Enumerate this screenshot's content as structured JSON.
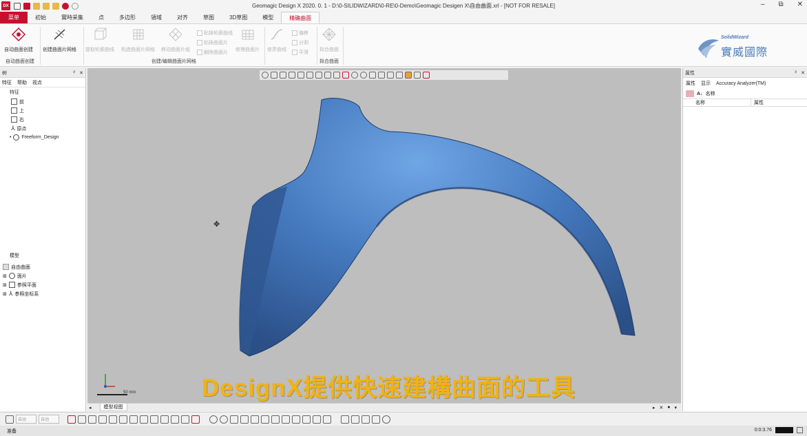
{
  "window": {
    "title": "Geomagic Design X 2020. 0. 1 - D:\\0-SILIDWIZARD\\0-RE\\0-Demo\\Geomagic Desigen X\\自由曲面.xrl - [NOT FOR RESALE]",
    "app_logo": "DX",
    "minimize": "–",
    "restore": "⧉",
    "close": "✕"
  },
  "menu": {
    "home": "菜单",
    "tabs": [
      "初始",
      "實時采集",
      "点",
      "多边形",
      "領域",
      "对齐",
      "草图",
      "3D草图",
      "模型",
      "精确曲面"
    ],
    "active_index": 9
  },
  "ribbon": {
    "btn_auto_surface": "自动曲面创建",
    "btn_create_patch_grid": "创建曲面片网格",
    "btn_extract_contour": "提取轮廓曲线",
    "btn_patch_grid": "构造曲面片网格",
    "btn_move_patch": "移动曲面片组",
    "small_1": "贴抹轮廓曲线",
    "small_2": "贴抹曲面片",
    "small_3": "删除曲面片",
    "btn_repair": "修理曲面片",
    "btn_pull_curve": "修弄曲线",
    "small_4": "偏移",
    "small_5": "分割",
    "small_6": "平滑",
    "btn_fit": "拟合曲面",
    "group_auto": "自动曲面创建",
    "group_create": "创建/编辑曲面片网格",
    "group_fit": "拟合曲面"
  },
  "brand": {
    "small": "SolidWizard",
    "big": "實威國際"
  },
  "left_panel": {
    "title": "树",
    "pin": "ᵖ",
    "close": "✕",
    "tabs": [
      "特征",
      "帮助",
      "视点"
    ],
    "features_label": "特征",
    "feature_items": [
      "前",
      "上",
      "右",
      "原点",
      "Freeform_Design"
    ],
    "model_label": "模型",
    "model_items": [
      "自由曲面",
      "面片",
      "参照平面",
      "参照坐标系"
    ]
  },
  "right_panel": {
    "title": "属性",
    "tabs": [
      "属性",
      "显示",
      "Accuracy Analyzer(TM)"
    ],
    "name_label": "名称",
    "col_name": "名称",
    "col_prop": "属性"
  },
  "viewport": {
    "subtitle": "DesignX提供快速建構曲面的工具",
    "scale": "50 mm",
    "tab": "模型视图",
    "model_color": "#4a7ec2"
  },
  "bottom": {
    "drop1": "自动",
    "drop2": "自动"
  },
  "status": {
    "left": "准备",
    "time": "0:0:3.76"
  }
}
